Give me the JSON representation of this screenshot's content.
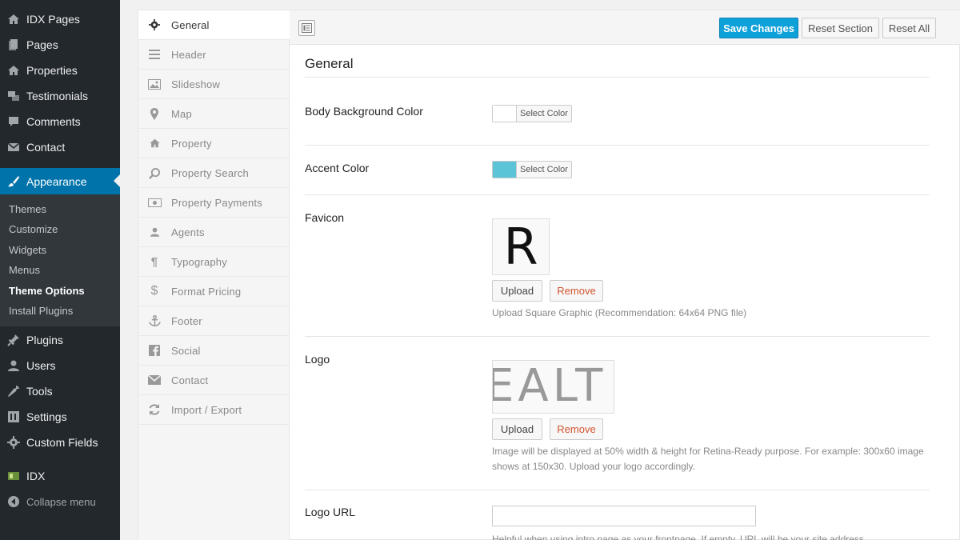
{
  "wp_menu": {
    "items": [
      {
        "label": "IDX Pages",
        "icon": "home-icon"
      },
      {
        "label": "Pages",
        "icon": "pages-icon"
      },
      {
        "label": "Properties",
        "icon": "home-icon"
      },
      {
        "label": "Testimonials",
        "icon": "testimonials-icon"
      },
      {
        "label": "Comments",
        "icon": "comment-icon"
      },
      {
        "label": "Contact",
        "icon": "mail-icon"
      },
      {
        "label": "Appearance",
        "icon": "paintbrush-icon"
      },
      {
        "label": "Plugins",
        "icon": "plugin-icon"
      },
      {
        "label": "Users",
        "icon": "user-icon"
      },
      {
        "label": "Tools",
        "icon": "wrench-icon"
      },
      {
        "label": "Settings",
        "icon": "settings-icon"
      },
      {
        "label": "Custom Fields",
        "icon": "gear-icon"
      },
      {
        "label": "IDX",
        "icon": "idx-icon"
      }
    ],
    "submenu": [
      "Themes",
      "Customize",
      "Widgets",
      "Menus",
      "Theme Options",
      "Install Plugins"
    ],
    "collapse_label": "Collapse menu"
  },
  "options_nav": {
    "items": [
      {
        "label": "General",
        "icon": "gear-icon"
      },
      {
        "label": "Header",
        "icon": "menu-lines-icon"
      },
      {
        "label": "Slideshow",
        "icon": "image-icon"
      },
      {
        "label": "Map",
        "icon": "map-marker-icon"
      },
      {
        "label": "Property",
        "icon": "home-icon"
      },
      {
        "label": "Property Search",
        "icon": "search-icon"
      },
      {
        "label": "Property Payments",
        "icon": "money-icon"
      },
      {
        "label": "Agents",
        "icon": "user-icon"
      },
      {
        "label": "Typography",
        "icon": "paragraph-icon"
      },
      {
        "label": "Format Pricing",
        "icon": "dollar-icon"
      },
      {
        "label": "Footer",
        "icon": "anchor-icon"
      },
      {
        "label": "Social",
        "icon": "facebook-icon"
      },
      {
        "label": "Contact",
        "icon": "envelope-icon"
      },
      {
        "label": "Import / Export",
        "icon": "refresh-icon"
      }
    ]
  },
  "toolbar": {
    "save_label": "Save Changes",
    "reset_section_label": "Reset Section",
    "reset_all_label": "Reset All"
  },
  "main": {
    "title": "General",
    "body_bg": {
      "label": "Body Background Color",
      "button": "Select Color",
      "color": "#ffffff"
    },
    "accent": {
      "label": "Accent Color",
      "button": "Select Color",
      "color": "#5bc4d6"
    },
    "favicon": {
      "label": "Favicon",
      "preview_text": "R",
      "upload": "Upload",
      "remove": "Remove",
      "help": "Upload Square Graphic (Recommendation: 64x64 PNG file)"
    },
    "logo": {
      "label": "Logo",
      "preview_text": "EALT",
      "upload": "Upload",
      "remove": "Remove",
      "help": "Image will be displayed at 50% width & height for Retina-Ready purpose. For example: 300x60 image shows at 150x30. Upload your logo accordingly."
    },
    "logo_url": {
      "label": "Logo URL",
      "value": "",
      "help": "Helpful when using intro page as your frontpage. If empty, URL will be your site address."
    }
  },
  "colors": {
    "wp_sidebar": "#23282d",
    "wp_active": "#0073aa",
    "primary_button": "#0ea0d8",
    "remove_text": "#d2532e"
  }
}
